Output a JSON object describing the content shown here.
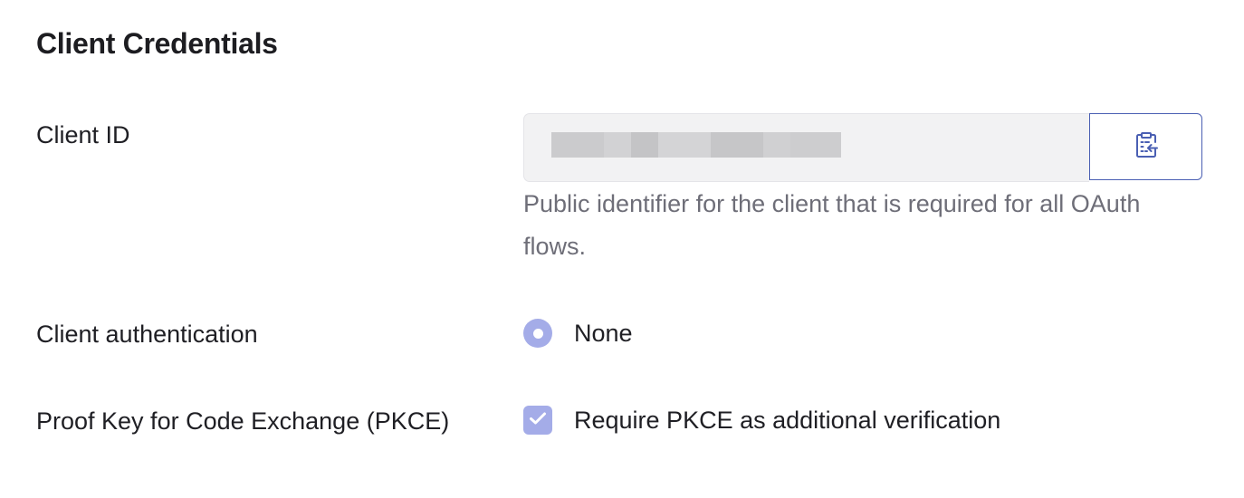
{
  "section": {
    "title": "Client Credentials"
  },
  "client_id": {
    "label": "Client ID",
    "value_display": "redacted (blurred)",
    "helper_text": "Public identifier for the client that is required for all OAuth flows.",
    "copy_icon": "clipboard-copy-icon"
  },
  "client_authentication": {
    "label": "Client authentication",
    "option_label": "None",
    "selected": true
  },
  "pkce": {
    "label": "Proof Key for Code Exchange (PKCE)",
    "option_label": "Require PKCE as additional verification",
    "checked": true
  },
  "colors": {
    "accent_border": "#4a5fb3",
    "control_fill": "#a4ace8",
    "helper_text": "#6e6e78",
    "field_background": "#f2f2f3"
  }
}
